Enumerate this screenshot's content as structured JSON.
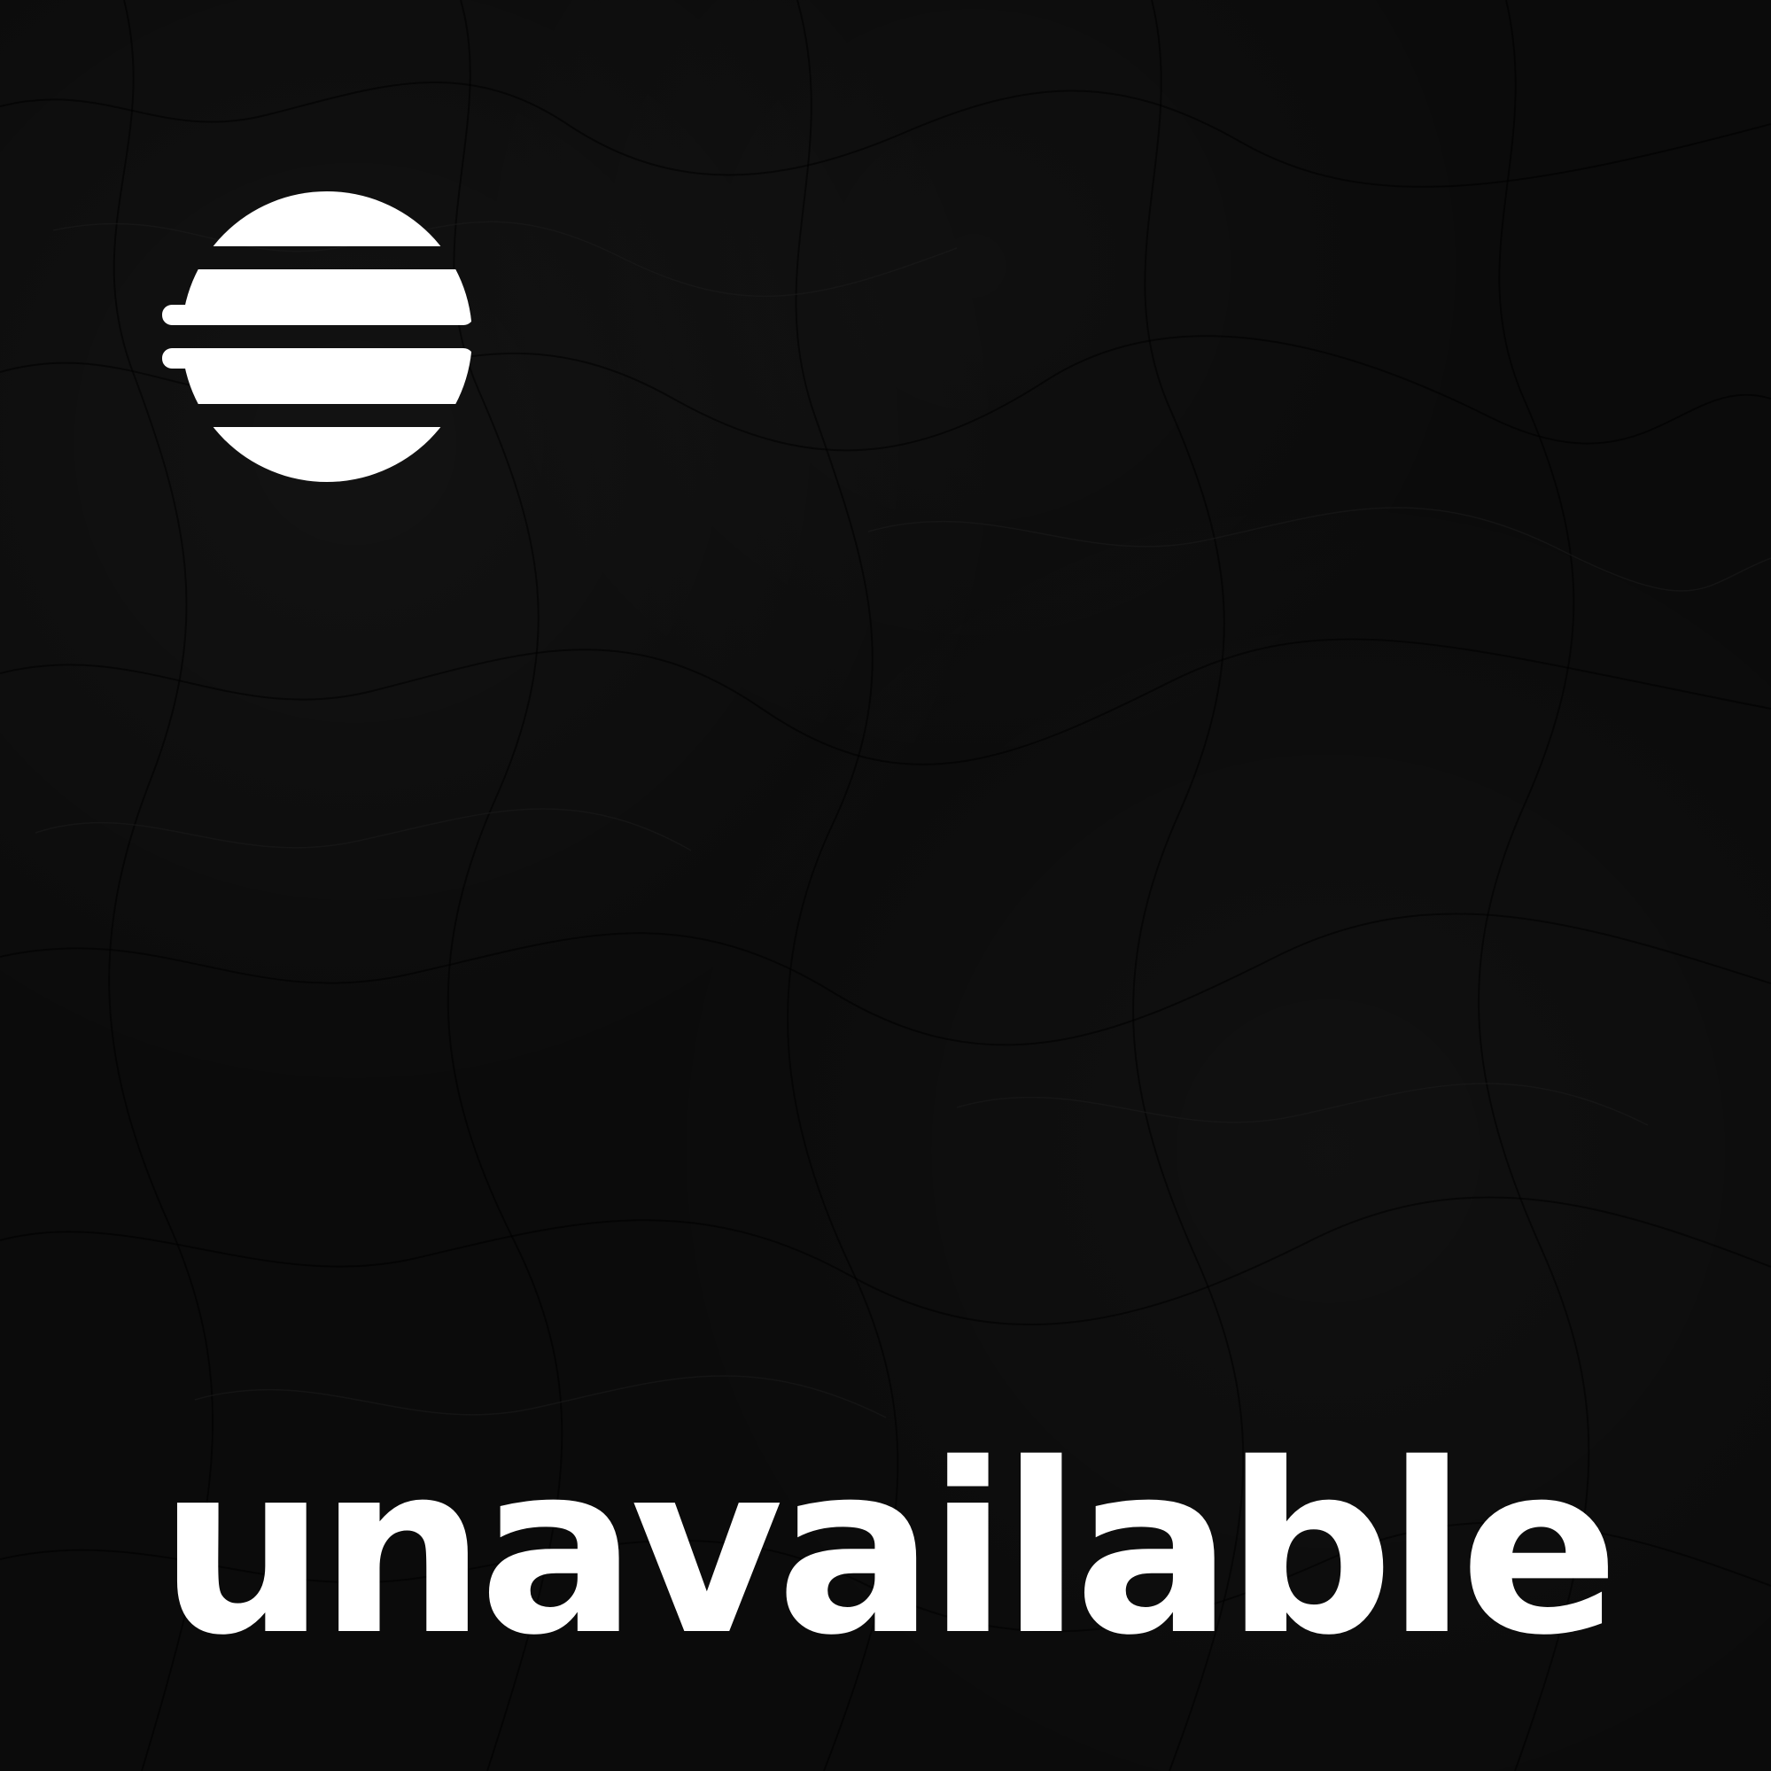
{
  "logo": {
    "icon": "striped-circle-logo-icon",
    "color": "#ffffff"
  },
  "status": {
    "text": "unavailable"
  },
  "background": {
    "color": "#0b0b0b",
    "texture": "dark-marble"
  }
}
